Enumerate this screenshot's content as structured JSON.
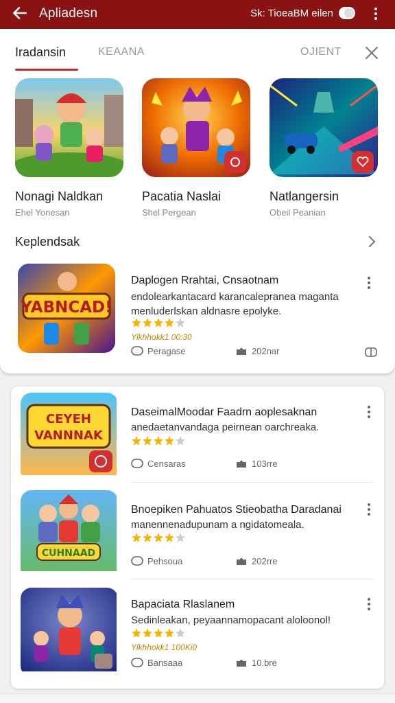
{
  "appbar": {
    "title": "Apliadesn",
    "account": "Sk: TioeaBM eilen"
  },
  "tabs": {
    "active": "Iradansin",
    "second": "KEAANA",
    "third": "OJIENT"
  },
  "featured": [
    {
      "name": "Nonagi Naldkan",
      "publisher": "Ehel Yonesan"
    },
    {
      "name": "Pacatia Naslai",
      "publisher": "Shel Pergean"
    },
    {
      "name": "Natlangersin",
      "publisher": "Obeil Peanian"
    }
  ],
  "section": {
    "title": "Keplendsak"
  },
  "rows": [
    {
      "title": "Daplogen Rrahtai, Cnsaotnam",
      "desc": "endolearkantacard karancalepranea maganta menluderlskan aldnasre epolyke.",
      "rating": 4,
      "reviews": "Ylkhhokk1 00:30",
      "meta1": "Peragase",
      "meta2": "202nar",
      "icon_text": "YABNCAD!"
    },
    {
      "title": "DaseimalMoodar Faadrn aoplesaknan",
      "desc": "anedaetanvandaga peirnean oarchreaka.",
      "rating": 4,
      "reviews": "",
      "meta1": "Censaras",
      "meta2": "103rre",
      "icon_text": "CEYEH VANNNAK"
    },
    {
      "title": "Bnoepiken Pahuatos Stieobatha Daradanai",
      "desc": "manennenadupunam a ngidatomeala.",
      "rating": 4,
      "reviews": "",
      "meta1": "Pehsoua",
      "meta2": "202rre",
      "icon_text": "CUHNAAD"
    },
    {
      "title": "Bapaciata Rlaslanem",
      "desc": "Sedinleakan, peyaannamopacant aloloonol!",
      "rating": 4,
      "reviews": "Ylkhhokk1 100Ki0",
      "meta1": "Bansaaa",
      "meta2": "10.bre",
      "icon_text": ""
    }
  ],
  "colors": {
    "appbar": "#8b1212",
    "accent": "#c62828",
    "star": "#f4b400"
  }
}
